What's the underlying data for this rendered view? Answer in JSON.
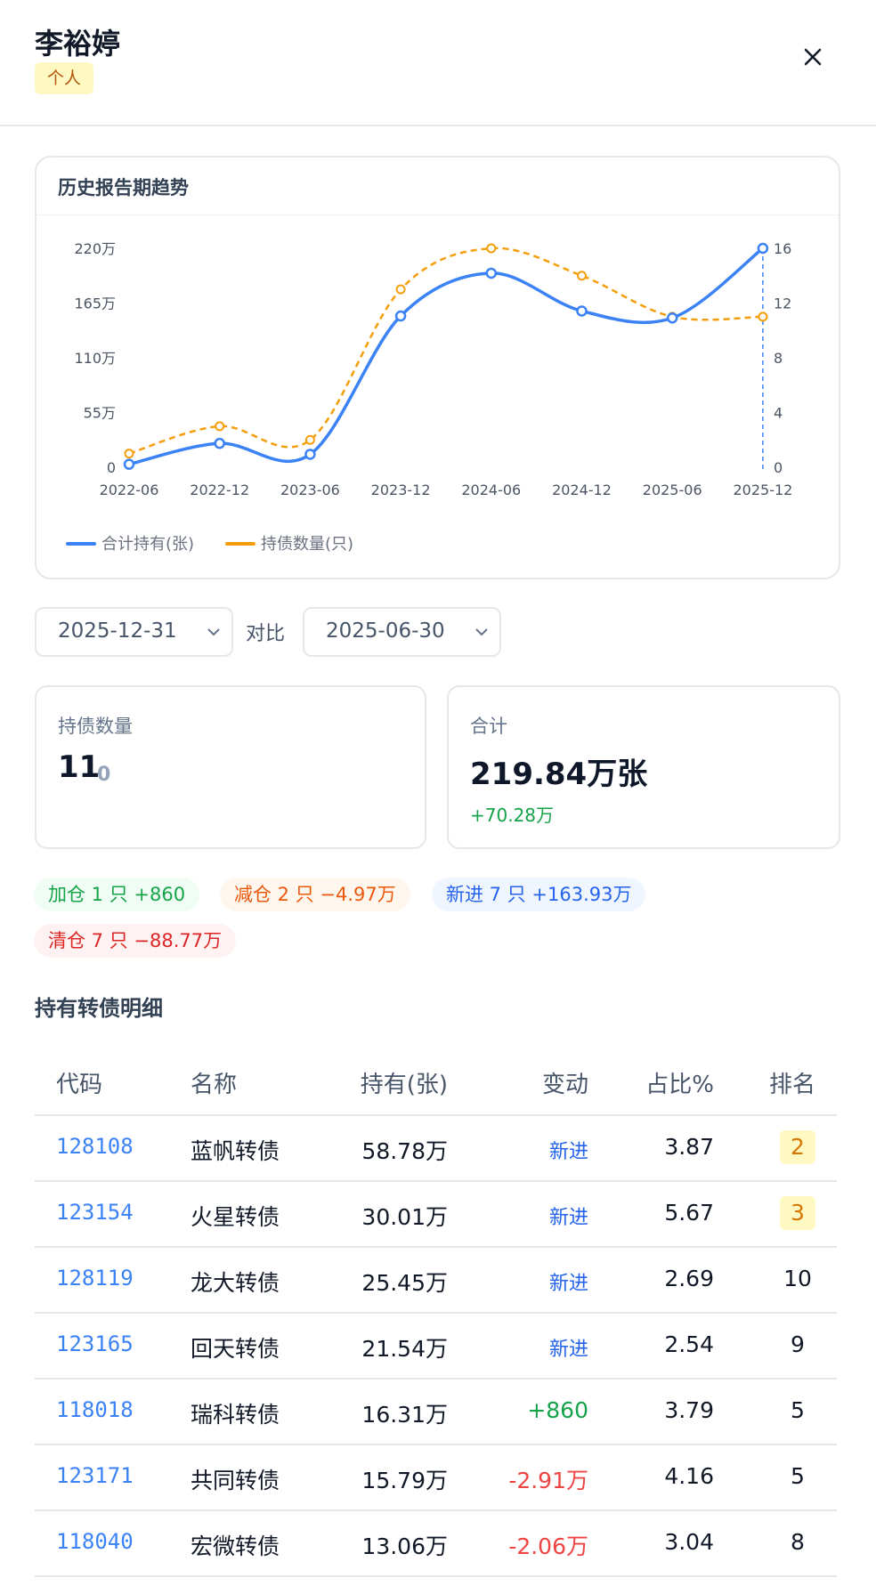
{
  "header": {
    "title": "李裕婷",
    "type_badge": "个人"
  },
  "chart_card": {
    "title": "历史报告期趋势"
  },
  "chart_data": {
    "type": "line",
    "x": [
      "2022-06",
      "2022-12",
      "2023-06",
      "2023-12",
      "2024-06",
      "2024-12",
      "2025-06",
      "2025-12"
    ],
    "y_left_ticks": [
      "220万",
      "165万",
      "110万",
      "55万",
      "0"
    ],
    "y_right_ticks": [
      "16",
      "12",
      "8",
      "4",
      "0"
    ],
    "y_left_range": [
      0,
      220
    ],
    "y_right_range": [
      0,
      16
    ],
    "series": [
      {
        "name": "合计持有(张)",
        "axis": "left",
        "unit": "万",
        "color": "#3b82f6",
        "style": "solid",
        "values": [
          3,
          24,
          13,
          152,
          195,
          157,
          150,
          220
        ]
      },
      {
        "name": "持债数量(只)",
        "axis": "right",
        "unit": "只",
        "color": "#f59e0b",
        "style": "dashed",
        "values": [
          1,
          3,
          2,
          13,
          16,
          14,
          11,
          11
        ]
      }
    ],
    "legend": "bottom-left"
  },
  "selectors": {
    "current": "2025-12-31",
    "vs_label": "对比",
    "compare": "2025-06-30"
  },
  "stats": {
    "bond_count": {
      "label": "持债数量",
      "value": "11",
      "delta": "0"
    },
    "total": {
      "label": "合计",
      "value": "219.84万张",
      "delta": "+70.28万"
    }
  },
  "changes": [
    {
      "text": "加仓 1 只 +860",
      "color": "green"
    },
    {
      "text": "减仓 2 只 −4.97万",
      "color": "orange"
    },
    {
      "text": "新进 7 只 +163.93万",
      "color": "blue"
    },
    {
      "text": "清仓 7 只 −88.77万",
      "color": "red"
    }
  ],
  "detail": {
    "title": "持有转债明细",
    "columns": [
      "代码",
      "名称",
      "持有(张)",
      "变动",
      "占比%",
      "排名"
    ],
    "rows": [
      {
        "code": "128108",
        "name": "蓝帆转债",
        "hold": "58.78万",
        "change": "新进",
        "kind": "new",
        "pct": "3.87",
        "rank": "2",
        "hi": true
      },
      {
        "code": "123154",
        "name": "火星转债",
        "hold": "30.01万",
        "change": "新进",
        "kind": "new",
        "pct": "5.67",
        "rank": "3",
        "hi": true
      },
      {
        "code": "128119",
        "name": "龙大转债",
        "hold": "25.45万",
        "change": "新进",
        "kind": "new",
        "pct": "2.69",
        "rank": "10",
        "hi": false
      },
      {
        "code": "123165",
        "name": "回天转债",
        "hold": "21.54万",
        "change": "新进",
        "kind": "new",
        "pct": "2.54",
        "rank": "9",
        "hi": false
      },
      {
        "code": "118018",
        "name": "瑞科转债",
        "hold": "16.31万",
        "change": "+860",
        "kind": "pos",
        "pct": "3.79",
        "rank": "5",
        "hi": false
      },
      {
        "code": "123171",
        "name": "共同转债",
        "hold": "15.79万",
        "change": "-2.91万",
        "kind": "neg",
        "pct": "4.16",
        "rank": "5",
        "hi": false
      },
      {
        "code": "118040",
        "name": "宏微转债",
        "hold": "13.06万",
        "change": "-2.06万",
        "kind": "neg",
        "pct": "3.04",
        "rank": "8",
        "hi": false
      }
    ]
  }
}
